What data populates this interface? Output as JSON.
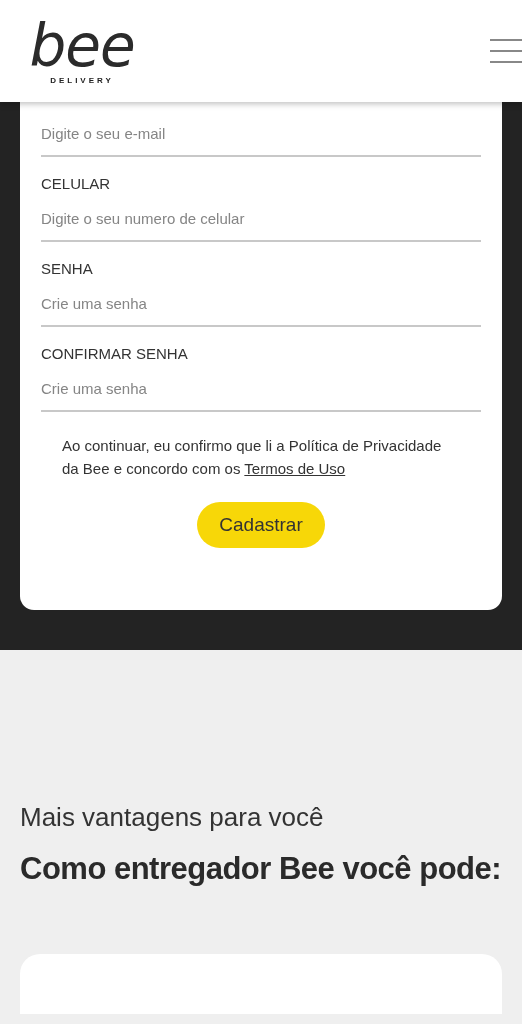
{
  "header": {
    "logo": "bee",
    "logo_subtitle": "DELIVERY"
  },
  "form": {
    "fields": [
      {
        "placeholder": "Digite o seu e-mail"
      },
      {
        "label": "CELULAR",
        "placeholder": "Digite o seu numero de celular"
      },
      {
        "label": "SENHA",
        "placeholder": "Crie uma senha"
      },
      {
        "label": "CONFIRMAR SENHA",
        "placeholder": "Crie uma senha"
      }
    ],
    "consent": {
      "text": "Ao continuar, eu confirmo que li a Política de Privacidade da Bee e concordo com os",
      "link": "Termos de Uso"
    },
    "submit": "Cadastrar"
  },
  "benefits": {
    "subtitle": "Mais vantagens para você",
    "title": "Como entregador Bee você pode:"
  }
}
